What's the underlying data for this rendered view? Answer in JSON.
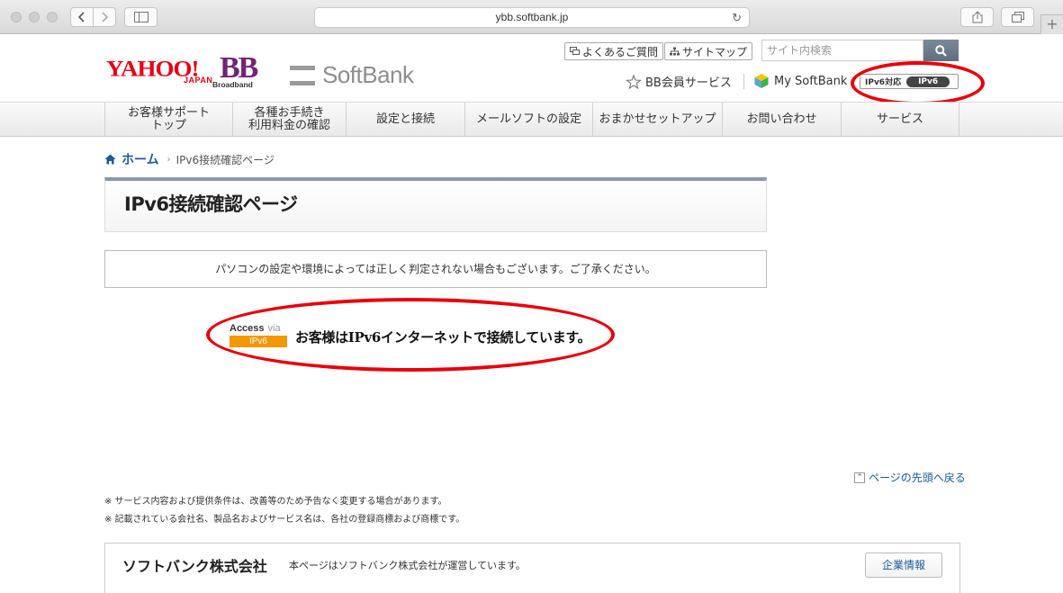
{
  "browser": {
    "url": "ybb.softbank.jp",
    "new_tab": "+"
  },
  "header": {
    "yahoo_logo": "YAHOO!",
    "yahoo_japan": "JAPAN",
    "bb_logo": "BB",
    "bb_sub": "Broadband",
    "softbank_logo": "SoftBank",
    "faq_label": "よくあるご質問",
    "sitemap_label": "サイトマップ",
    "search_placeholder": "サイト内検索",
    "bb_member_label": "BB会員サービス",
    "mysoftbank_label": "My SoftBank",
    "ipv6_badge_label": "IPv6対応",
    "ipv6_badge_pill": "IPv6"
  },
  "nav": [
    {
      "label": "お客様サポート\nトップ"
    },
    {
      "label": "各種お手続き\n利用料金の確認"
    },
    {
      "label": "設定と接続"
    },
    {
      "label": "メールソフトの設定"
    },
    {
      "label": "おまかせセットアップ"
    },
    {
      "label": "お問い合わせ"
    },
    {
      "label": "サービス"
    }
  ],
  "breadcrumb": {
    "home": "ホーム",
    "current": "IPv6接続確認ページ"
  },
  "page": {
    "title": "IPv6接続確認ページ",
    "notice": "パソコンの設定や環境によっては正しく判定されない場合もございます。ご了承ください。",
    "access_label": "Access",
    "access_via": "via",
    "access_pill": "IPv6",
    "result": "お客様はIPv6インターネットで接続しています。",
    "to_top": "ページの先頭へ戻る",
    "note1": "※ サービス内容および提供条件は、改善等のため予告なく変更する場合があります。",
    "note2": "※ 記載されている会社名、製品名およびサービス名は、各社の登録商標および商標です。"
  },
  "footer": {
    "company": "ソフトバンク株式会社",
    "desc": "本ページはソフトバンク株式会社が運営しています。",
    "corp_info": "企業情報"
  },
  "colors": {
    "annotation_ring": "#e8000b",
    "link_blue": "#1a5b99",
    "ipv6_orange": "#f39800"
  }
}
